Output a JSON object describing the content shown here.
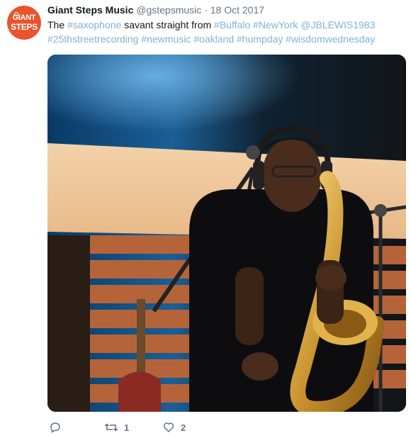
{
  "tweet": {
    "author": {
      "avatar_lines": [
        "GIANT",
        "STEPS"
      ],
      "name": "Giant Steps Music",
      "handle": "@gstepsmusic",
      "separator": "·",
      "date": "18 Oct 2017"
    },
    "text_parts": [
      {
        "t": "The ",
        "tag": false
      },
      {
        "t": "#saxophone",
        "tag": true
      },
      {
        "t": " savant straight from ",
        "tag": false
      },
      {
        "t": "#Buffalo",
        "tag": true
      },
      {
        "t": " ",
        "tag": false
      },
      {
        "t": "#NewYork",
        "tag": true
      },
      {
        "t": " ",
        "tag": false
      },
      {
        "t": "@JBLEWIS1983",
        "tag": true
      },
      {
        "t": " ",
        "tag": false
      },
      {
        "t": "#25thstreetrecording",
        "tag": true
      },
      {
        "t": " ",
        "tag": false
      },
      {
        "t": "#newmusic",
        "tag": true
      },
      {
        "t": " ",
        "tag": false
      },
      {
        "t": "#oakland",
        "tag": true
      },
      {
        "t": " ",
        "tag": false
      },
      {
        "t": "#humpday",
        "tag": true
      },
      {
        "t": " ",
        "tag": false
      },
      {
        "t": "#wisdomwednesday",
        "tag": true
      }
    ],
    "actions": {
      "reply": {
        "icon": "reply-icon",
        "count": ""
      },
      "retweet": {
        "icon": "retweet-icon",
        "count": "1"
      },
      "like": {
        "icon": "heart-icon",
        "count": "2"
      }
    },
    "colors": {
      "hashtag": "#7fb2d8",
      "avatar": "#e8542c",
      "muted": "#657786"
    }
  }
}
